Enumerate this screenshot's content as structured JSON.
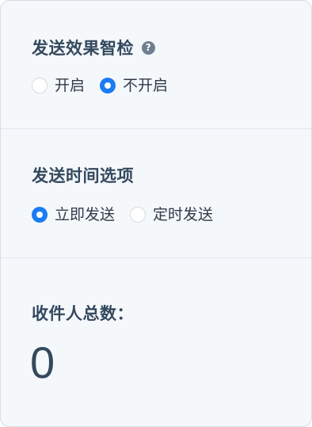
{
  "effect_check": {
    "title": "发送效果智检",
    "help_icon": "question-circle-icon",
    "help_glyph": "?",
    "options": [
      {
        "label": "开启",
        "checked": false
      },
      {
        "label": "不开启",
        "checked": true
      }
    ]
  },
  "send_time": {
    "title": "发送时间选项",
    "options": [
      {
        "label": "立即发送",
        "checked": true
      },
      {
        "label": "定时发送",
        "checked": false
      }
    ]
  },
  "recipients": {
    "title": "收件人总数：",
    "count": "0"
  },
  "colors": {
    "accent": "#1b7cf3",
    "panel_bg": "#f5f8fb",
    "title_text": "#34495e"
  }
}
